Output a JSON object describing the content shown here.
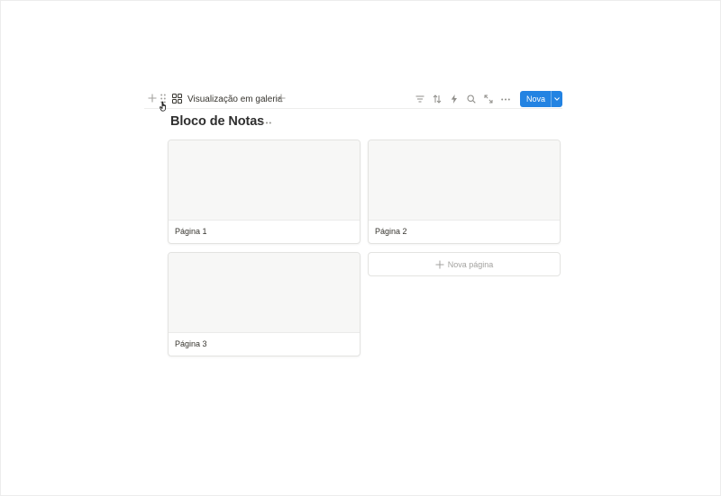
{
  "toolbar": {
    "view_label": "Visualização em galeria",
    "new_button_label": "Nova"
  },
  "database": {
    "title": "Bloco de Notas"
  },
  "cards": [
    {
      "title": "Página 1"
    },
    {
      "title": "Página 2"
    },
    {
      "title": "Página 3"
    }
  ],
  "new_page_label": "Nova página",
  "icons": [
    "plus-icon",
    "drag-handle-icon",
    "hand-cursor-icon",
    "gallery-icon",
    "filter-icon",
    "sort-icon",
    "lightning-icon",
    "search-icon",
    "expand-icon",
    "more-icon",
    "chevron-down-icon"
  ],
  "colors": {
    "accent": "#2383e2",
    "card_cover": "#f7f7f6",
    "border": "#e3e3e1",
    "text": "#37352f",
    "muted": "#a3a29f"
  }
}
